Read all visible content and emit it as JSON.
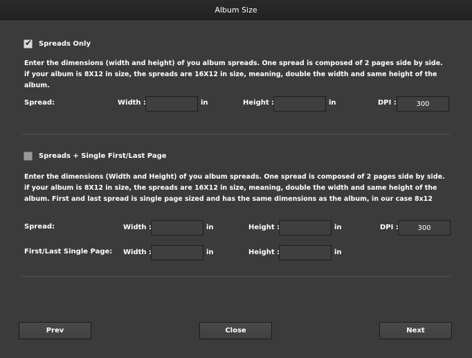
{
  "window": {
    "title": "Album Size"
  },
  "spreads_only": {
    "checked": true,
    "label": "Spreads Only",
    "description": "Enter the dimensions (width and height) of you album spreads. One spread is composed of 2 pages side by side. if your album is 8X12 in size, the spreads are 16X12 in size, meaning, double the width and same height of the album.",
    "row_label": "Spread:",
    "width_label": "Width :",
    "width_value": "",
    "height_label": "Height :",
    "height_value": "",
    "unit": "in",
    "dpi_label": "DPI :",
    "dpi_value": "300"
  },
  "spreads_single": {
    "checked": false,
    "label": "Spreads + Single First/Last Page",
    "description": "Enter the dimensions (Width and Height) of you album spreads. One spread is composed of 2 pages side by side. if your album is 8X12 in size, the spreads are 16X12 in size, meaning, double the width and same height of the album. First and last spread is single page sized and has the same dimensions as the album, in our case 8x12",
    "spread_row_label": "Spread:",
    "single_row_label": "First/Last Single Page:",
    "width_label": "Width :",
    "height_label": "Height :",
    "unit": "in",
    "dpi_label": "DPI :",
    "dpi_value": "300",
    "spread_width_value": "",
    "spread_height_value": "",
    "single_width_value": "",
    "single_height_value": ""
  },
  "buttons": {
    "prev": "Prev",
    "close": "Close",
    "next": "Next"
  }
}
